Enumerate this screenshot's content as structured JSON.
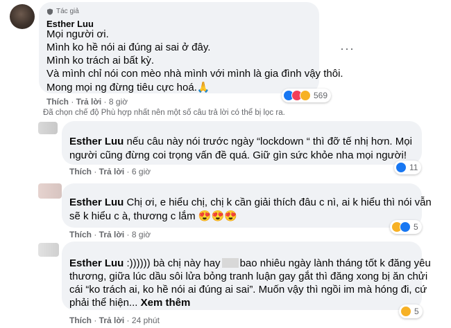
{
  "comments": [
    {
      "badge": "Tác giả",
      "author": "Esther Luu",
      "lines": [
        "Mọi người ơi.",
        "Mình ko hề nói ai đúng ai sai ở đây.",
        "Mình ko trách ai bất kỳ.",
        "Và mình chỉ nói con mèo nhà mình với mình là gia đình vậy thôi.",
        "Mong mọi ng đừng tiêu cực hoá.🙏"
      ],
      "reactions": [
        "like",
        "love",
        "care"
      ],
      "reaction_count": "569",
      "like_label": "Thích",
      "reply_label": "Trả lời",
      "time": "8 giờ"
    }
  ],
  "filter_note": "Đã chọn chế độ Phù hợp nhất nên một số câu trả lời có thể bị lọc ra.",
  "replies": [
    {
      "author": "Esther Luu",
      "line1": " nếu câu này nói trước ngày “lockdown “ thì đỡ tế nhị hơn. Mọi",
      "line2": "người cũng đừng coi trọng vấn đề quá. Giữ gìn sức khỏe nha mọi người!",
      "reaction_count": "11",
      "like_label": "Thích",
      "reply_label": "Trả lời",
      "time": "6 giờ"
    },
    {
      "author": "Esther Luu",
      "line1": " Chị ơi, e hiểu chị, chị k cần giải thích đâu c nì, ai k hiểu thì nói vẫn",
      "line2": "sẽ k hiểu c à, thương c lắm 😍😍😍",
      "reaction_count": "5",
      "like_label": "Thích",
      "reply_label": "Trả lời",
      "time": "8 giờ"
    },
    {
      "author": "Esther Luu",
      "line1a": " :)))))) bà chị này hay",
      "line1b": "bao nhiêu ngày lành tháng tốt k đăng yêu",
      "line2": "thương, giữa lúc dầu sôi lửa bỏng tranh luận gay gắt thì đăng xong bị ăn chửi",
      "line3": "cái “ko trách ai, ko hề nói ai đúng ai sai”. Muốn vậy thì ngồi im mà hóng đi, cứ",
      "line4": "phải thể hiện...",
      "see_more": "Xem thêm",
      "reaction_count": "5",
      "like_label": "Thích",
      "reply_label": "Trả lời",
      "time": "24 phút"
    }
  ],
  "colors": {
    "bubble": "#f0f2f5",
    "meta": "#65676b",
    "like": "#1877f2",
    "love": "#f33e58",
    "haha": "#f7b125"
  },
  "icons": [
    "author-shield-icon",
    "more-options-icon",
    "like-icon",
    "love-icon",
    "care-icon",
    "haha-icon"
  ]
}
